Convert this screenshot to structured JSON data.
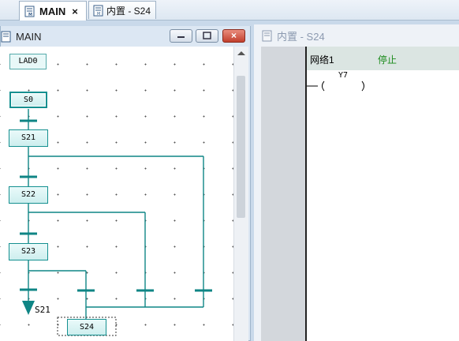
{
  "tabs": [
    {
      "label": "MAIN",
      "close": "×",
      "active": true,
      "icon": "document-icon"
    },
    {
      "label": "内置 - S24",
      "active": false,
      "icon": "document-icon"
    }
  ],
  "main_window": {
    "title": "MAIN",
    "buttons": {
      "minimize": "minimize-icon",
      "restore": "restore-icon",
      "close": "×"
    }
  },
  "sfc": {
    "header_label": "LAD0",
    "steps": [
      "S0",
      "S21",
      "S22",
      "S23",
      "S24"
    ],
    "jump_target": "S21"
  },
  "ladder_window": {
    "title": "内置 - S24",
    "network_label": "网络1",
    "status": "停止",
    "coil_label": "Y7",
    "status_color": "#1a8a1a"
  }
}
